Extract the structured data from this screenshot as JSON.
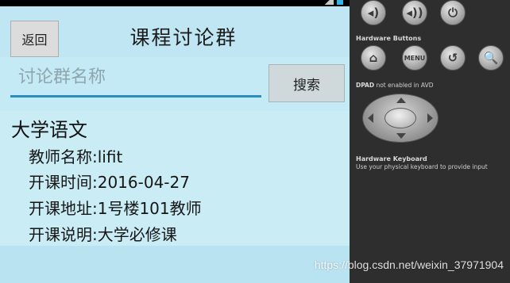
{
  "app": {
    "back_label": "返回",
    "title": "课程讨论群",
    "search": {
      "placeholder": "讨论群名称",
      "value": "",
      "button_label": "搜索"
    },
    "group": {
      "course_name": "大学语文",
      "teacher": "教师名称:lifit",
      "start_time": "开课时间:2016-04-27",
      "location": "开课地址:1号楼101教师",
      "description": "开课说明:大学必修课"
    }
  },
  "emulator_panel": {
    "top_buttons": [
      {
        "icon": "volume-down-icon",
        "glyph": "◂)"
      },
      {
        "icon": "volume-up-icon",
        "glyph": "◂))"
      },
      {
        "icon": "power-icon",
        "glyph": "⏻"
      }
    ],
    "hardware_buttons_label": "Hardware Buttons",
    "hardware_buttons": [
      {
        "icon": "home-icon",
        "glyph": "⌂"
      },
      {
        "icon": "menu-icon",
        "glyph": "MENU"
      },
      {
        "icon": "back-icon",
        "glyph": "↺"
      },
      {
        "icon": "search-icon",
        "glyph": "🔍"
      }
    ],
    "dpad_note_bold": "DPAD",
    "dpad_note_rest": " not enabled in AVD",
    "keyboard_label": "Hardware Keyboard",
    "keyboard_note": "Use your physical keyboard to provide input"
  },
  "watermark": "https://blog.csdn.net/weixin_37971904"
}
